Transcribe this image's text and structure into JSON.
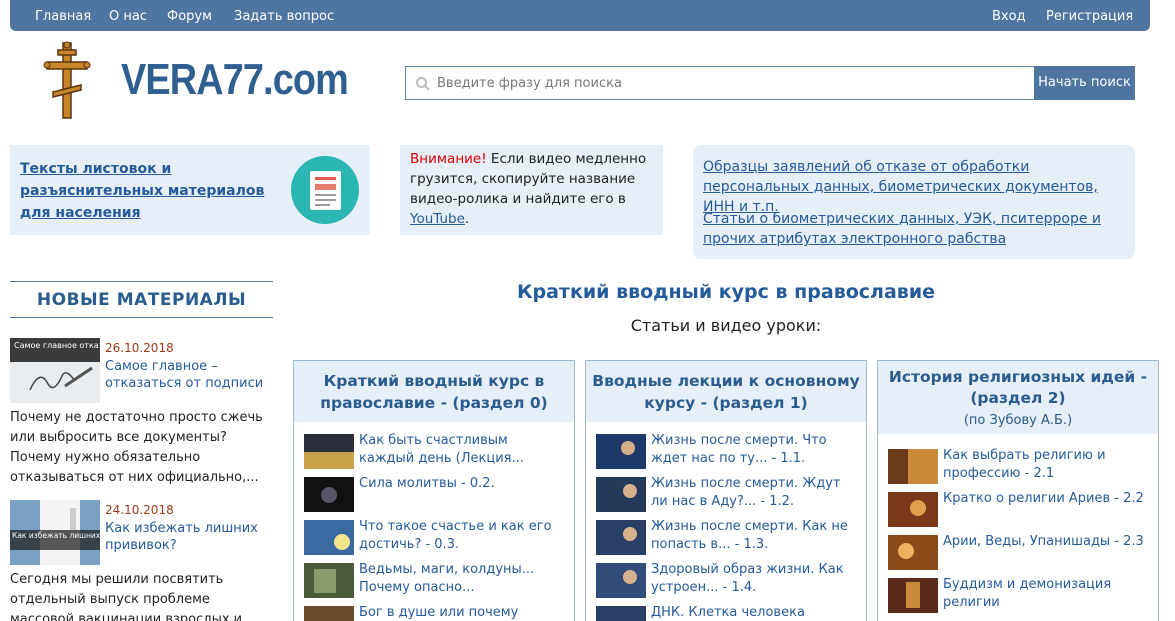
{
  "nav": {
    "left": [
      "Главная",
      "О нас",
      "Форум",
      "Задать вопрос"
    ],
    "right": [
      "Вход",
      "Регистрация"
    ]
  },
  "logo": {
    "text": "VERA77.com"
  },
  "search": {
    "placeholder": "Введите фразу для поиска",
    "button": "Начать поиск"
  },
  "box1": {
    "link": "Тексты листовок и разъяснительных материалов для населения"
  },
  "box2": {
    "warn": "Внимание!",
    "text": " Если видео медленно грузится, скопируйте название видео-ролика и найдите его в ",
    "yt": "YouTube",
    "end": "."
  },
  "box3": {
    "link1": "Образцы заявлений об отказе от обработки персональных данных, биометрических документов, ИНН и т.п.",
    "link2": "Статьи о биометрических данных, УЭК, пситерроре и прочих атрибутах электронного рабства"
  },
  "sidebar": {
    "title": "НОВЫЕ МАТЕРИАЛЫ",
    "items": [
      {
        "date": "26.10.2018",
        "title": "Самое главное – отказаться от подписи",
        "thumb_text": "Самое главное отказаться от подписи",
        "text": "Почему не достаточно просто сжечь или выбросить все документы? Почему нужно обязательно отказываться от них официально,..."
      },
      {
        "date": "24.10.2018",
        "title": "Как избежать лишних прививок?",
        "thumb_text": "Как избежать лишних прививок?",
        "text": "Сегодня мы решили посвятить отдельный выпуск проблеме массовой вакцинации взрослых и детей, к которой"
      }
    ]
  },
  "course": {
    "title": "Краткий вводный курс в православие",
    "subtitle": "Статьи и видео уроки:"
  },
  "columns": [
    {
      "title": "Краткий вводный курс в православие - (раздел 0)",
      "sub": "",
      "videos": [
        "Как быть счастливым каждый день (Лекция...",
        "Сила молитвы - 0.2.",
        "Что такое счастье и как его достичь? - 0.3.",
        "Ведьмы, маги, колдуны... Почему опасно...",
        "Бог в душе или почему человек"
      ]
    },
    {
      "title": "Вводные лекции к основному курсу - (раздел 1)",
      "sub": "",
      "videos": [
        "Жизнь после смерти. Что ждет нас по ту... - 1.1.",
        "Жизнь после смерти. Ждут ли нас в Аду?... - 1.2.",
        "Жизнь после смерти. Как не попасть в... - 1.3.",
        "Здоровый образ жизни. Как устроен... - 1.4.",
        "ДНК. Клетка человека (Лекция"
      ]
    },
    {
      "title": "История религиозных идей - (раздел 2)",
      "sub": "(по Зубову А.Б.)",
      "videos": [
        "Как выбрать религию и профессию - 2.1",
        "Кратко о религии Ариев - 2.2",
        "Арии, Веды, Упанишады - 2.3",
        "Буддизм и демонизация религии"
      ]
    }
  ],
  "colors": {
    "nav": "#4f76a0",
    "link": "#245b9a",
    "box": "#e6eef7",
    "warn": "#dd0000"
  }
}
